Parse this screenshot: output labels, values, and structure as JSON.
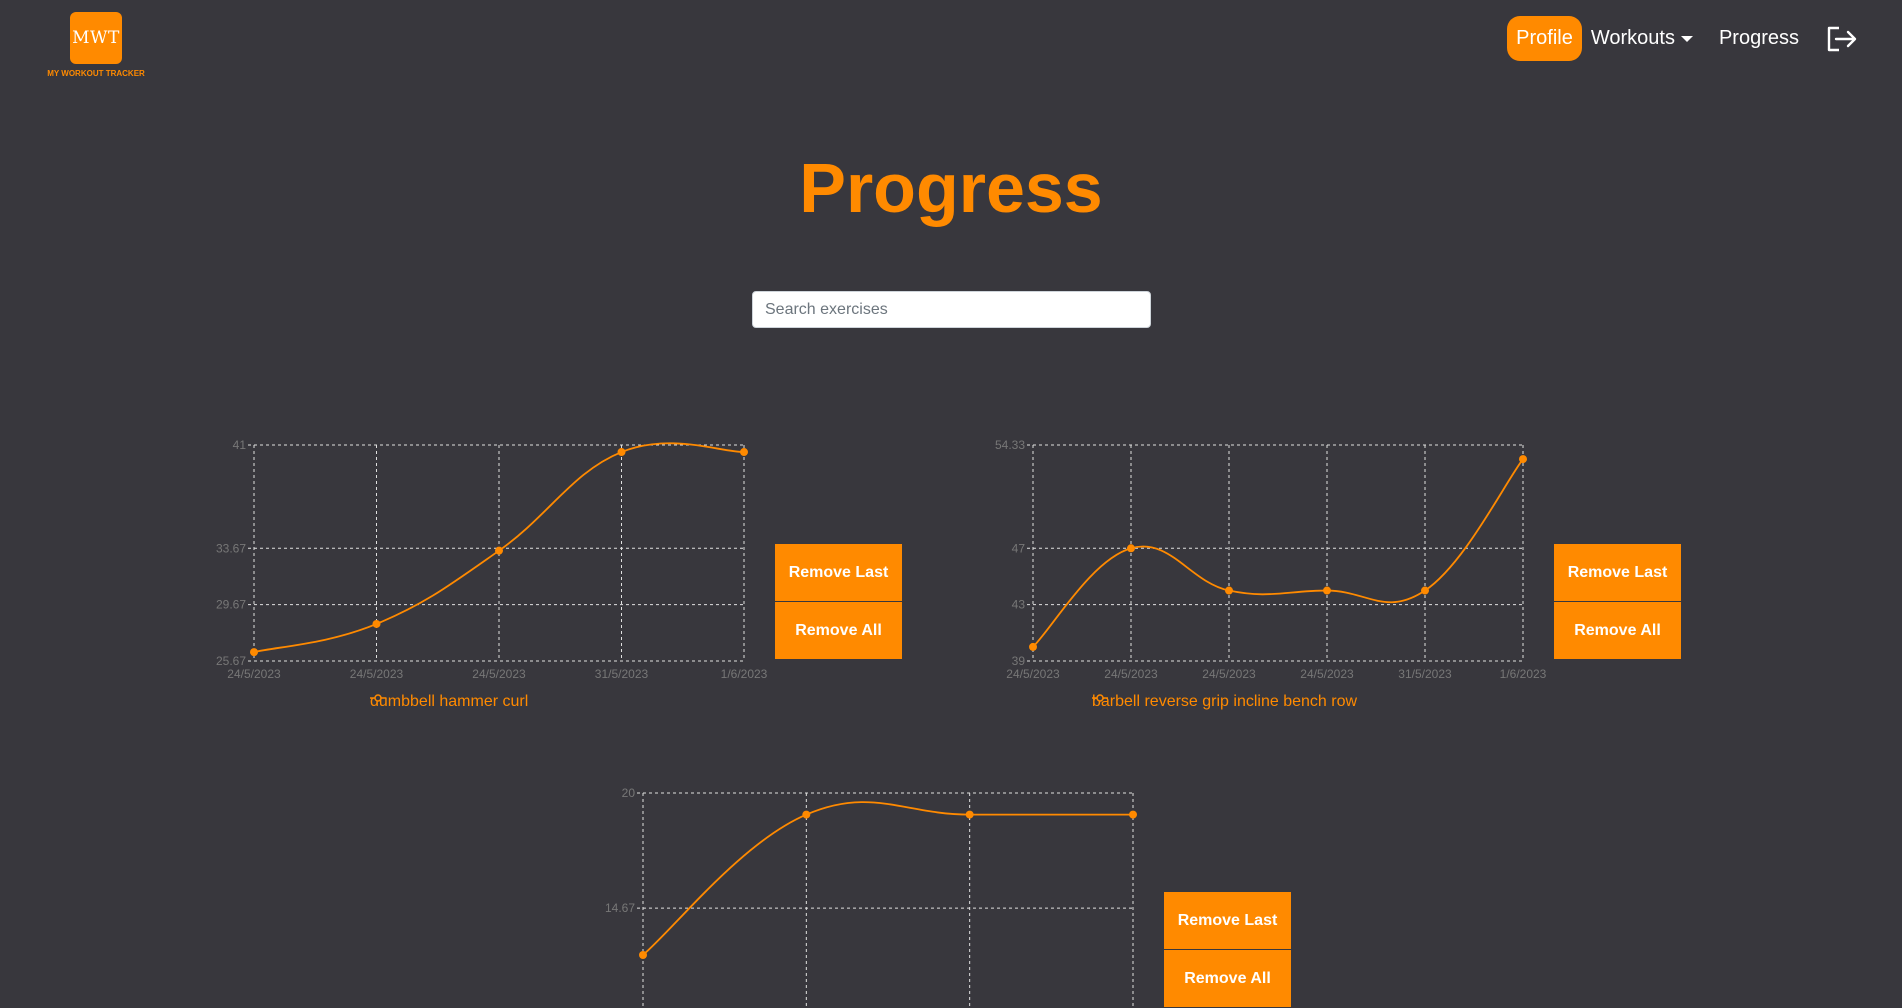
{
  "logo": {
    "mark": "MWT",
    "subtitle": "MY WORKOUT TRACKER"
  },
  "nav": {
    "profile": "Profile",
    "workouts": "Workouts",
    "progress": "Progress",
    "logout_icon": "logout-icon"
  },
  "page": {
    "title": "Progress"
  },
  "search": {
    "placeholder": "Search exercises",
    "value": ""
  },
  "colors": {
    "accent": "#ff8a00",
    "background": "#38373d",
    "grid": "#e0e0e0",
    "tick": "#777777"
  },
  "charts": [
    {
      "remove_last": "Remove Last",
      "remove_all": "Remove All"
    },
    {
      "remove_last": "Remove Last",
      "remove_all": "Remove All"
    },
    {
      "remove_last": "Remove Last",
      "remove_all": "Remove All"
    }
  ],
  "chart_data": [
    {
      "type": "line",
      "x": [
        "24/5/2023",
        "24/5/2023",
        "24/5/2023",
        "31/5/2023",
        "1/6/2023"
      ],
      "series": [
        {
          "name": "dumbbell hammer curl",
          "values": [
            26.3,
            28.3,
            33.5,
            40.5,
            40.5
          ]
        }
      ],
      "yticks": [
        "25.67",
        "29.67",
        "33.67",
        "41"
      ],
      "ylim": [
        25.67,
        41
      ],
      "grid": true,
      "legend": "bottom"
    },
    {
      "type": "line",
      "x": [
        "24/5/2023",
        "24/5/2023",
        "24/5/2023",
        "24/5/2023",
        "31/5/2023",
        "1/6/2023"
      ],
      "series": [
        {
          "name": "barbell reverse grip incline bench row",
          "values": [
            40,
            47,
            44,
            44,
            44,
            53.33
          ]
        }
      ],
      "yticks": [
        "39",
        "43",
        "47",
        "54.33"
      ],
      "ylim": [
        39,
        54.33
      ],
      "grid": true,
      "legend": "bottom"
    },
    {
      "type": "line",
      "x": [
        "",
        "",
        "",
        ""
      ],
      "series": [
        {
          "name": "",
          "values": [
            12.5,
            19,
            19,
            19
          ]
        }
      ],
      "yticks": [
        "14.67",
        "20"
      ],
      "ylim": [
        10,
        20
      ],
      "grid": true,
      "legend": "bottom"
    }
  ]
}
